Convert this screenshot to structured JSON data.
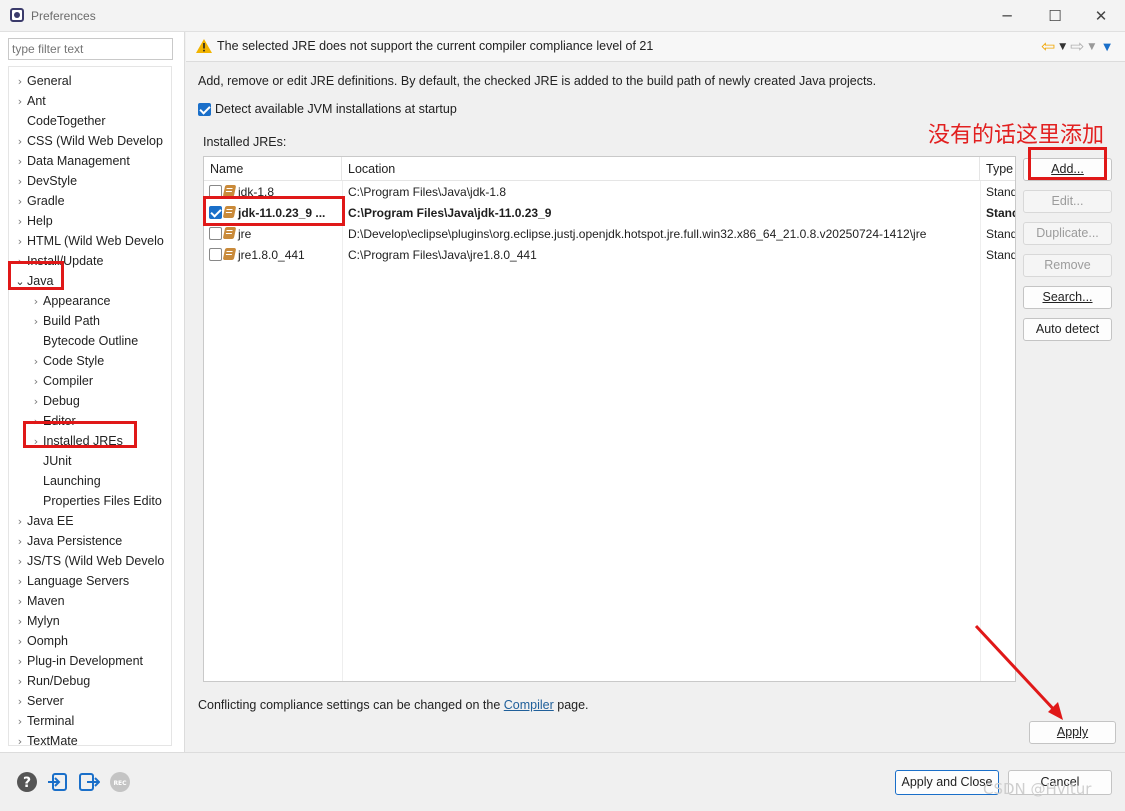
{
  "window": {
    "title": "Preferences",
    "minimize": "─",
    "maximize": "☐",
    "close": "✕"
  },
  "sidebar": {
    "filter_placeholder": "type filter text",
    "items": [
      {
        "label": "General",
        "expander": "›",
        "level": 0
      },
      {
        "label": "Ant",
        "expander": "›",
        "level": 0
      },
      {
        "label": "CodeTogether",
        "expander": "",
        "level": 0
      },
      {
        "label": "CSS (Wild Web Develop",
        "expander": "›",
        "level": 0
      },
      {
        "label": "Data Management",
        "expander": "›",
        "level": 0
      },
      {
        "label": "DevStyle",
        "expander": "›",
        "level": 0
      },
      {
        "label": "Gradle",
        "expander": "›",
        "level": 0
      },
      {
        "label": "Help",
        "expander": "›",
        "level": 0
      },
      {
        "label": "HTML (Wild Web Develo",
        "expander": "›",
        "level": 0
      },
      {
        "label": "Install/Update",
        "expander": "›",
        "level": 0
      },
      {
        "label": "Java",
        "expander": "⌄",
        "level": 0
      },
      {
        "label": "Appearance",
        "expander": "›",
        "level": 1
      },
      {
        "label": "Build Path",
        "expander": "›",
        "level": 1
      },
      {
        "label": "Bytecode Outline",
        "expander": "",
        "level": 1
      },
      {
        "label": "Code Style",
        "expander": "›",
        "level": 1
      },
      {
        "label": "Compiler",
        "expander": "›",
        "level": 1
      },
      {
        "label": "Debug",
        "expander": "›",
        "level": 1
      },
      {
        "label": "Editor",
        "expander": "›",
        "level": 1
      },
      {
        "label": "Installed JREs",
        "expander": "›",
        "level": 1
      },
      {
        "label": "JUnit",
        "expander": "",
        "level": 1
      },
      {
        "label": "Launching",
        "expander": "",
        "level": 1
      },
      {
        "label": "Properties Files Edito",
        "expander": "",
        "level": 1
      },
      {
        "label": "Java EE",
        "expander": "›",
        "level": 0
      },
      {
        "label": "Java Persistence",
        "expander": "›",
        "level": 0
      },
      {
        "label": "JS/TS (Wild Web Develo",
        "expander": "›",
        "level": 0
      },
      {
        "label": "Language Servers",
        "expander": "›",
        "level": 0
      },
      {
        "label": "Maven",
        "expander": "›",
        "level": 0
      },
      {
        "label": "Mylyn",
        "expander": "›",
        "level": 0
      },
      {
        "label": "Oomph",
        "expander": "›",
        "level": 0
      },
      {
        "label": "Plug-in Development",
        "expander": "›",
        "level": 0
      },
      {
        "label": "Run/Debug",
        "expander": "›",
        "level": 0
      },
      {
        "label": "Server",
        "expander": "›",
        "level": 0
      },
      {
        "label": "Terminal",
        "expander": "›",
        "level": 0
      },
      {
        "label": "TextMate",
        "expander": "›",
        "level": 0
      }
    ]
  },
  "main": {
    "warning": "The selected JRE does not support the current compiler compliance level of 21",
    "description": "Add, remove or edit JRE definitions. By default, the checked JRE is added to the build path of newly created Java projects.",
    "detect_label": "Detect available JVM installations at startup",
    "detect_checked": true,
    "installed_label": "Installed JREs:",
    "annotation": "没有的话这里添加",
    "columns": [
      "Name",
      "Location",
      "Type"
    ],
    "jres": [
      {
        "name": "jdk-1.8",
        "location": "C:\\Program Files\\Java\\jdk-1.8",
        "type": "Standard VM",
        "checked": false,
        "bold": false
      },
      {
        "name": "jdk-11.0.23_9 ...",
        "location": "C:\\Program Files\\Java\\jdk-11.0.23_9",
        "type": "Standard VM",
        "checked": true,
        "bold": true
      },
      {
        "name": "jre",
        "location": "D:\\Develop\\eclipse\\plugins\\org.eclipse.justj.openjdk.hotspot.jre.full.win32.x86_64_21.0.8.v20250724-1412\\jre",
        "type": "Standard VM",
        "checked": false,
        "bold": false
      },
      {
        "name": "jre1.8.0_441",
        "location": "C:\\Program Files\\Java\\jre1.8.0_441",
        "type": "Standard VM",
        "checked": false,
        "bold": false
      }
    ],
    "buttons": {
      "add": "Add...",
      "edit": "Edit...",
      "duplicate": "Duplicate...",
      "remove": "Remove",
      "search": "Search...",
      "auto_detect": "Auto detect"
    },
    "conflict_prefix": "Conflicting compliance settings can be changed on the ",
    "conflict_link": "Compiler",
    "conflict_suffix": " page.",
    "apply": "Apply"
  },
  "footer": {
    "apply_close": "Apply and Close",
    "cancel": "Cancel",
    "icons": [
      "help-icon",
      "import-icon",
      "export-icon",
      "record-icon"
    ],
    "record_label": "REC"
  },
  "watermark": "CSDN @Hvitur",
  "colors": {
    "annotation_red": "#e01818",
    "accent_blue": "#1a6fc9",
    "warning_yellow": "#f2b400",
    "nav_orange": "#f0a500"
  }
}
